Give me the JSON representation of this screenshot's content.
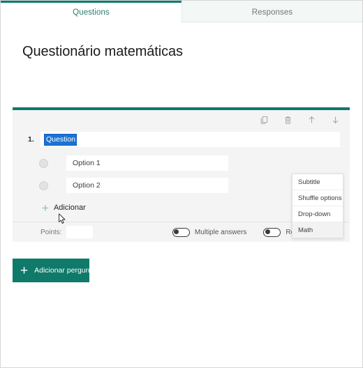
{
  "tabs": [
    {
      "label": "Questions",
      "active": true
    },
    {
      "label": "Responses",
      "active": false
    }
  ],
  "form": {
    "title": "Questionário matemáticas"
  },
  "question_card": {
    "toolbar": [
      {
        "icon": "copy-icon",
        "name": "duplicate-question-button"
      },
      {
        "icon": "trash-icon",
        "name": "delete-question-button"
      },
      {
        "icon": "arrow-up-icon",
        "name": "move-question-up-button"
      },
      {
        "icon": "arrow-down-icon",
        "name": "move-question-down-button"
      }
    ],
    "number": "1.",
    "question_text": "Question",
    "question_text_selected": true,
    "options": [
      {
        "label": "Option 1"
      },
      {
        "label": "Option 2"
      }
    ],
    "add_option_label": "Adicionar",
    "footer": {
      "points_label": "Points:",
      "points_value": "",
      "multiple_answers_label": "Multiple answers",
      "multiple_answers_on": false,
      "required_label": "Required",
      "required_on": false,
      "more_label": "..."
    }
  },
  "context_menu": {
    "items": [
      {
        "label": "Subtitle",
        "hover": false
      },
      {
        "label": "Shuffle options",
        "hover": false
      },
      {
        "label": "Drop-down",
        "hover": false
      },
      {
        "label": "Math",
        "hover": true
      }
    ]
  },
  "add_question_button": {
    "label": "Adicionar pergunta"
  },
  "colors": {
    "accent_teal": "#0f7a6a",
    "tab_active_text": "#2b7a6f",
    "selection_blue": "#1a73d4"
  }
}
